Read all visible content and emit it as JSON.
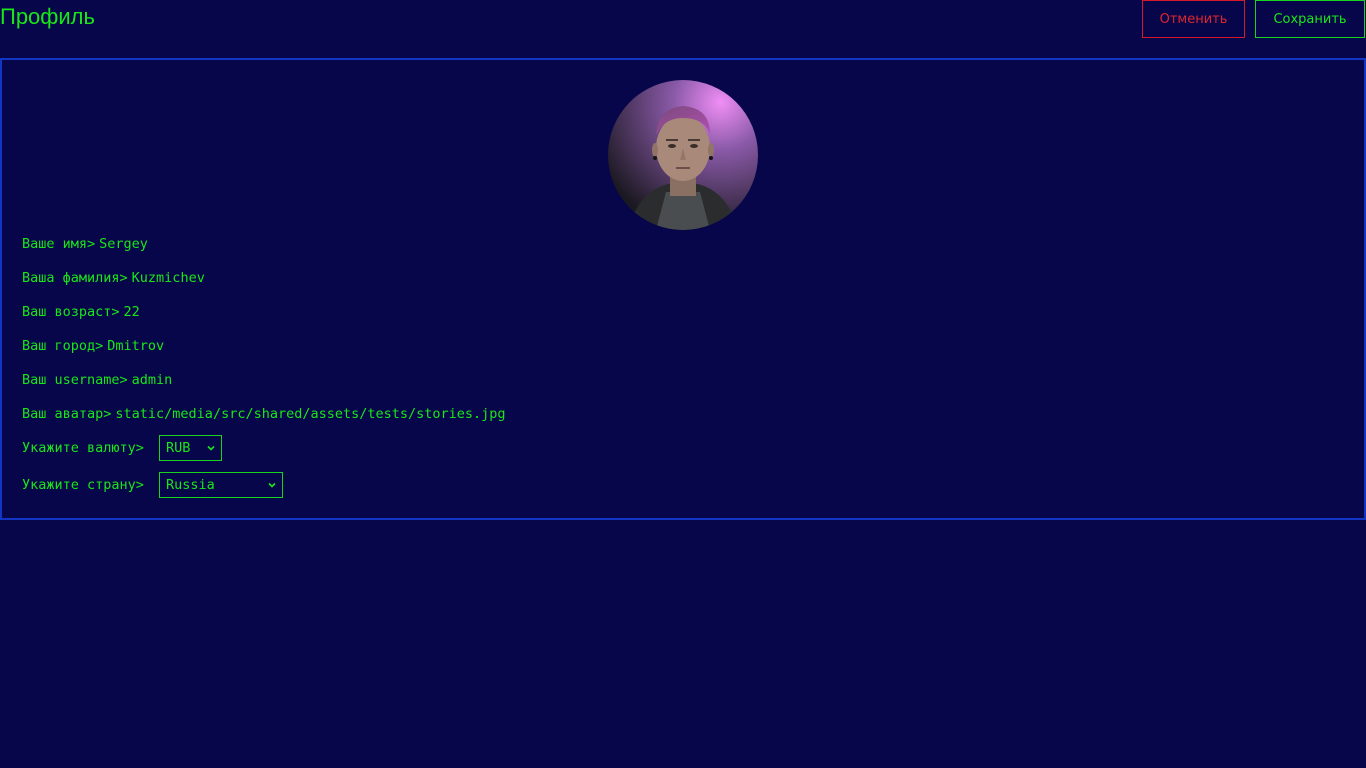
{
  "header": {
    "title": "Профиль",
    "cancel_label": "Отменить",
    "save_label": "Сохранить"
  },
  "profile": {
    "fields": [
      {
        "label": "Ваше имя>",
        "value": "Sergey"
      },
      {
        "label": "Ваша фамилия>",
        "value": "Kuzmichev"
      },
      {
        "label": "Ваш возраст>",
        "value": "22"
      },
      {
        "label": "Ваш город>",
        "value": "Dmitrov"
      },
      {
        "label": "Ваш username>",
        "value": "admin"
      },
      {
        "label": "Ваш аватар>",
        "value": "static/media/src/shared/assets/tests/stories.jpg"
      }
    ],
    "currency": {
      "label": "Укажите валюту>",
      "selected": "RUB"
    },
    "country": {
      "label": "Укажите страну>",
      "selected": "Russia"
    }
  },
  "icons": {
    "select_chevron": "chevron-down-icon"
  },
  "colors": {
    "background": "#08064a",
    "accent_green": "#19e619",
    "cancel_red": "#e0242e",
    "card_border": "#1235c4"
  }
}
